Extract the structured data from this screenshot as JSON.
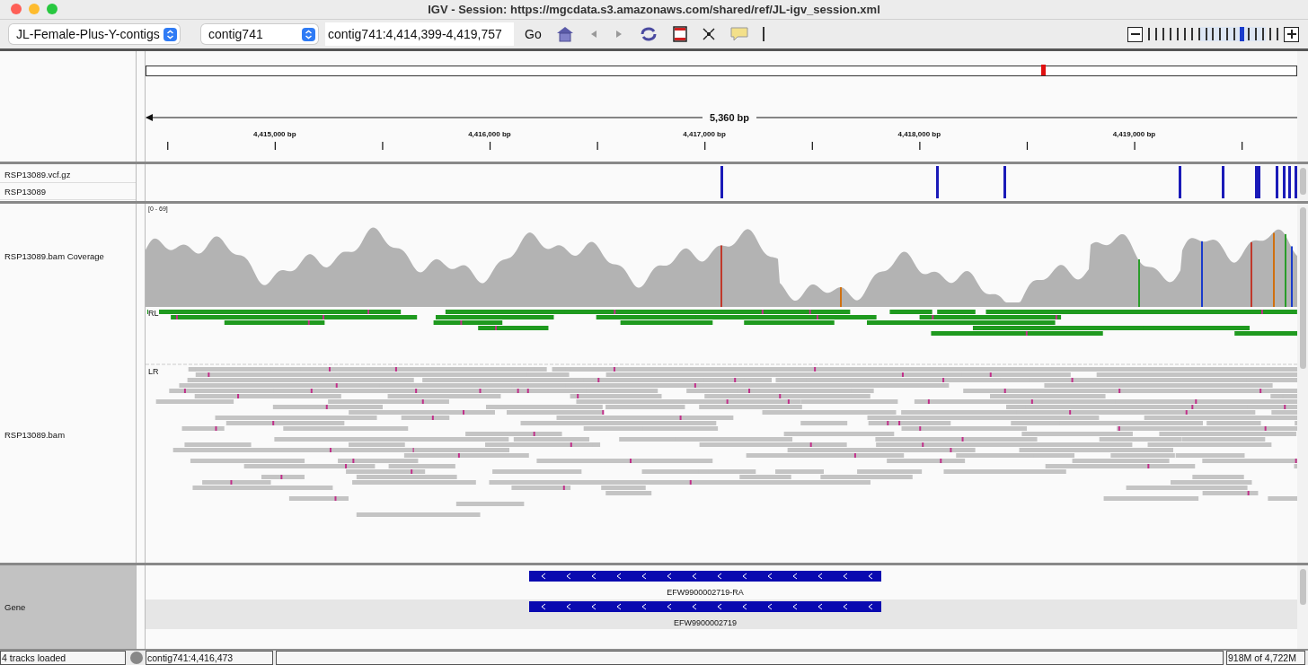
{
  "window": {
    "title": "IGV - Session: https://mgcdata.s3.amazonaws.com/shared/ref/JL-igv_session.xml"
  },
  "toolbar": {
    "genome": "JL-Female-Plus-Y-contigs",
    "chromosome": "contig741",
    "locus": "contig741:4,414,399-4,419,757",
    "go": "Go",
    "zoom": {
      "level": 0.7
    }
  },
  "ruler": {
    "span": "5,360 bp",
    "ticks": [
      "4,415,000 bp",
      "4,416,000 bp",
      "4,417,000 bp",
      "4,418,000 bp",
      "4,419,000 bp"
    ]
  },
  "variant_tracks": [
    "RSP13089.vcf.gz",
    "RSP13089"
  ],
  "alignment": {
    "coverage_name": "RSP13089.bam Coverage",
    "data_range": "[0 - 69]",
    "bam_name": "RSP13089.bam",
    "groups": [
      "RL",
      "LR"
    ]
  },
  "gene_track": {
    "name": "Gene",
    "features": [
      {
        "name": "EFW9900002719-RA"
      },
      {
        "name": "EFW9900002719"
      }
    ]
  },
  "status_bar": {
    "message": "4 tracks loaded",
    "position": "contig741:4,416,473",
    "memory": "918M of 4,722M"
  }
}
